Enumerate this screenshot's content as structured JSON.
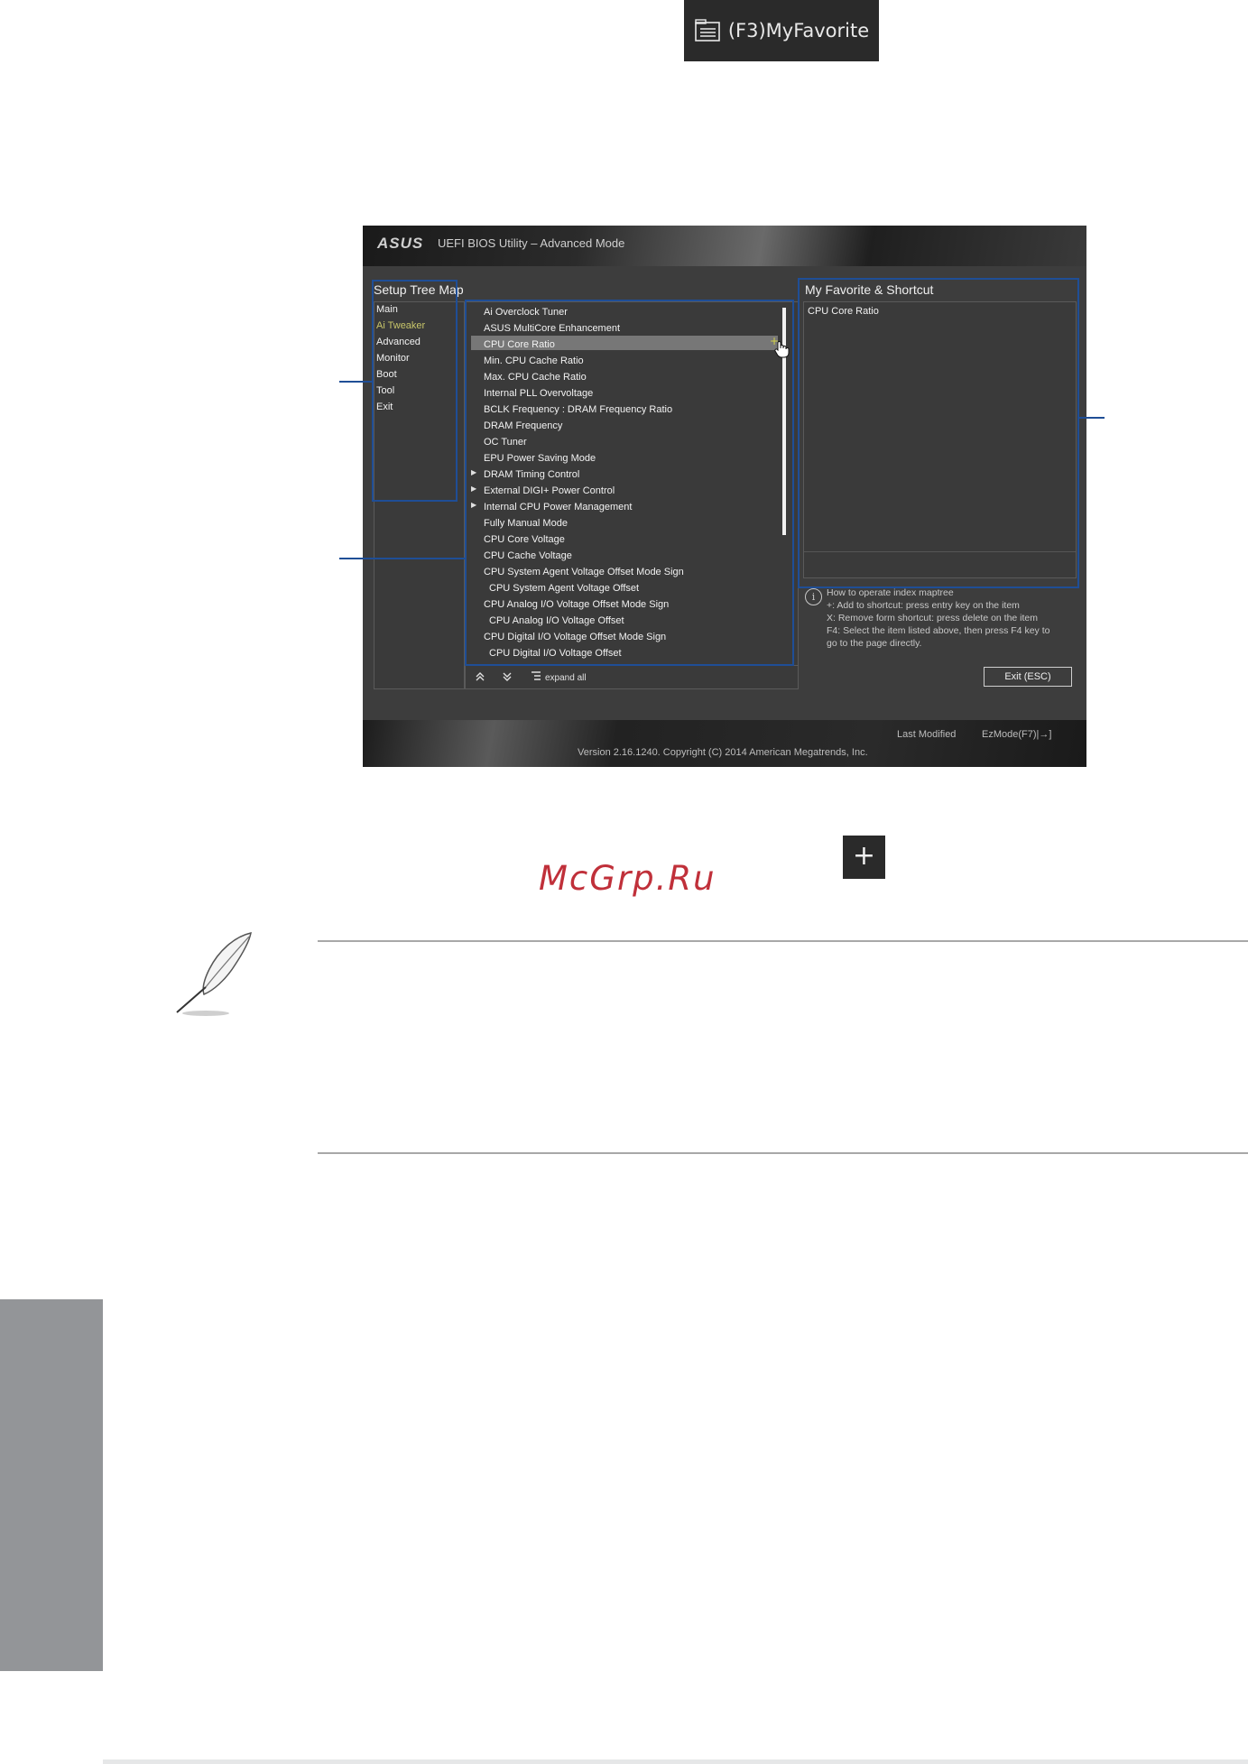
{
  "top_badge": {
    "label": "(F3)MyFavorite",
    "icon": "list-folder-icon"
  },
  "bios": {
    "header": {
      "logo": "ASUS",
      "title": "UEFI BIOS Utility – Advanced Mode"
    },
    "tree_map": {
      "title": "Setup Tree Map",
      "items": [
        "Main",
        "Ai Tweaker",
        "Advanced",
        "Monitor",
        "Boot",
        "Tool",
        "Exit"
      ],
      "active_index": 1
    },
    "menu_items": [
      {
        "label": "Ai Overclock Tuner",
        "sub": false,
        "arrow": false
      },
      {
        "label": "ASUS MultiCore Enhancement",
        "sub": false,
        "arrow": false
      },
      {
        "label": "CPU Core Ratio",
        "sub": false,
        "arrow": false
      },
      {
        "label": "Min. CPU Cache Ratio",
        "sub": false,
        "arrow": false
      },
      {
        "label": "Max. CPU Cache Ratio",
        "sub": false,
        "arrow": false
      },
      {
        "label": "Internal PLL Overvoltage",
        "sub": false,
        "arrow": false
      },
      {
        "label": "BCLK Frequency : DRAM Frequency Ratio",
        "sub": false,
        "arrow": false
      },
      {
        "label": "DRAM Frequency",
        "sub": false,
        "arrow": false
      },
      {
        "label": "OC Tuner",
        "sub": false,
        "arrow": false
      },
      {
        "label": "EPU Power Saving Mode",
        "sub": false,
        "arrow": false
      },
      {
        "label": "DRAM Timing Control",
        "sub": false,
        "arrow": true
      },
      {
        "label": "External DIGI+ Power Control",
        "sub": false,
        "arrow": true
      },
      {
        "label": "Internal CPU Power Management",
        "sub": false,
        "arrow": true
      },
      {
        "label": "Fully Manual Mode",
        "sub": false,
        "arrow": false
      },
      {
        "label": "CPU Core Voltage",
        "sub": false,
        "arrow": false
      },
      {
        "label": "CPU Cache Voltage",
        "sub": false,
        "arrow": false
      },
      {
        "label": "CPU System Agent Voltage Offset Mode Sign",
        "sub": false,
        "arrow": false
      },
      {
        "label": "CPU System Agent Voltage Offset",
        "sub": true,
        "arrow": false
      },
      {
        "label": "CPU Analog I/O Voltage Offset Mode Sign",
        "sub": false,
        "arrow": false
      },
      {
        "label": "CPU Analog I/O Voltage Offset",
        "sub": true,
        "arrow": false
      },
      {
        "label": "CPU Digital I/O Voltage Offset Mode Sign",
        "sub": false,
        "arrow": false
      },
      {
        "label": "CPU Digital I/O Voltage Offset",
        "sub": true,
        "arrow": false
      }
    ],
    "highlight_index": 2,
    "highlight_plus": "+",
    "toolbar": {
      "collapse_icon": "double-chevron-up-icon",
      "expand_icon": "double-chevron-down-icon",
      "expand_all_label": "expand all"
    },
    "favorites": {
      "title": "My Favorite & Shortcut",
      "items": [
        "CPU Core Ratio"
      ]
    },
    "help": {
      "info_glyph": "i",
      "lines": [
        "How to operate index maptree",
        "+: Add to shortcut: press entry key on the item",
        "X: Remove form shortcut: press delete on the item",
        "F4: Select the item listed above, then press F4 key to",
        "go to the page directly."
      ]
    },
    "exit_button": "Exit (ESC)",
    "footer": {
      "last_modified": "Last Modified",
      "ezmode": "EzMode(F7)|→]",
      "version": "Version 2.16.1240. Copyright (C) 2014 American Megatrends, Inc."
    }
  },
  "plus_icon_label": "+",
  "watermark": "McGrp.Ru",
  "colors": {
    "callout": "#1f4e96",
    "side_tab": "#939598",
    "bios_bg": "#3d3d3d",
    "active_item": "#c8c66a"
  }
}
